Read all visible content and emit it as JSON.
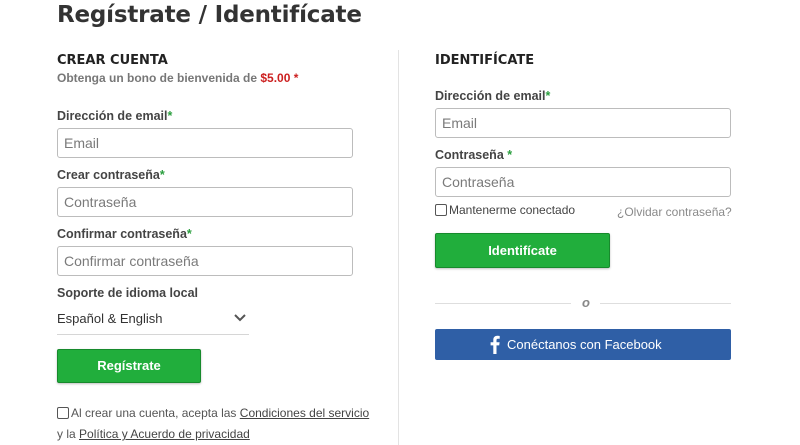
{
  "page": {
    "title": "Regístrate / Identifícate"
  },
  "register": {
    "heading": "CREAR CUENTA",
    "bonus_prefix": "Obtenga un bono de bienvenida de",
    "bonus_amount": "$5.00",
    "bonus_asterisk": "*",
    "email_label": "Dirección de email",
    "email_placeholder": "Email",
    "password_label": "Crear contraseña",
    "password_placeholder": "Contraseña",
    "confirm_label": "Confirmar contraseña",
    "confirm_placeholder": "Confirmar contraseña",
    "language_label": "Soporte de idioma local",
    "language_value": "Español & English",
    "submit_label": "Regístrate",
    "terms_prefix": "Al crear una cuenta, acepta las",
    "terms_link": "Condiciones del servicio",
    "terms_middle": "y la",
    "privacy_link": "Política y Acuerdo de privacidad"
  },
  "login": {
    "heading": "IDENTIFÍCATE",
    "email_label": "Dirección de email",
    "email_placeholder": "Email",
    "password_label": "Contraseña",
    "password_placeholder": "Contraseña",
    "remember_label": "Mantenerme conectado",
    "forgot_label": "¿Olvidar contraseña?",
    "submit_label": "Identifícate",
    "or_text": "o",
    "facebook_label": "Conéctanos con Facebook"
  },
  "required_mark": "*",
  "colors": {
    "accent_green": "#21ae3c",
    "facebook_blue": "#2f5fa6",
    "price_red": "#cc1f1f",
    "required_green": "#2a9e3e"
  },
  "icons": {
    "dropdown": "chevron-down-icon",
    "facebook": "facebook-icon"
  }
}
